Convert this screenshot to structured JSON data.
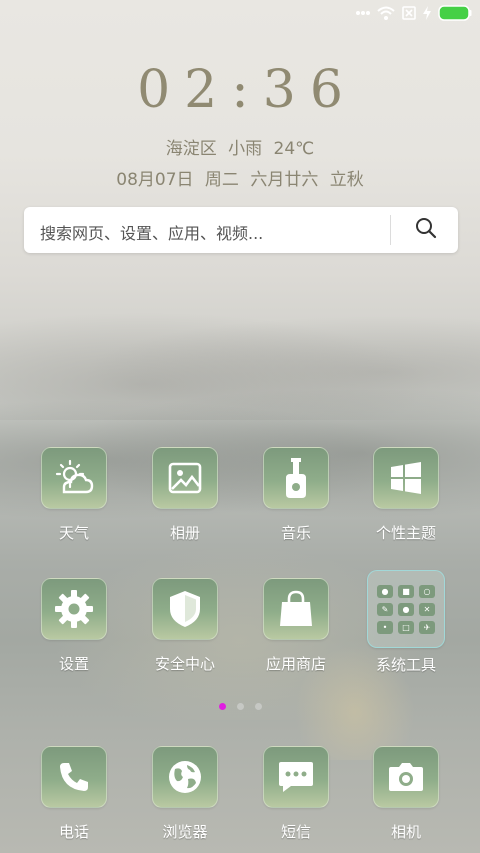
{
  "status_bar": {
    "icons": [
      "more-dots-icon",
      "wifi-icon",
      "no-sim-icon",
      "charging-icon",
      "battery-icon"
    ],
    "battery_color": "#45d046"
  },
  "lockscreen": {
    "time": "02:36",
    "weather": {
      "district": "海淀区",
      "condition": "小雨",
      "temperature": "24℃"
    },
    "date": {
      "date": "08月07日",
      "weekday": "周二",
      "lunar": "六月廿六",
      "solar_term": "立秋"
    }
  },
  "search": {
    "placeholder": "搜索网页、设置、应用、视频...",
    "icon": "search-icon"
  },
  "apps": [
    {
      "label": "天气",
      "icon": "weather-icon"
    },
    {
      "label": "相册",
      "icon": "gallery-icon"
    },
    {
      "label": "音乐",
      "icon": "music-icon"
    },
    {
      "label": "个性主题",
      "icon": "themes-icon"
    },
    {
      "label": "设置",
      "icon": "settings-icon"
    },
    {
      "label": "安全中心",
      "icon": "security-icon"
    },
    {
      "label": "应用商店",
      "icon": "app-store-icon"
    },
    {
      "label": "系统工具",
      "icon": "folder-icon"
    }
  ],
  "page_indicator": {
    "pages": 3,
    "current": 1,
    "active_color": "#e01ee0"
  },
  "dock": [
    {
      "label": "电话",
      "icon": "phone-icon"
    },
    {
      "label": "浏览器",
      "icon": "browser-icon"
    },
    {
      "label": "短信",
      "icon": "messages-icon"
    },
    {
      "label": "相机",
      "icon": "camera-icon"
    }
  ],
  "theme": {
    "icon_green": "#7d9a7d",
    "label_color": "#ffffff",
    "clock_color": "#908a72"
  }
}
